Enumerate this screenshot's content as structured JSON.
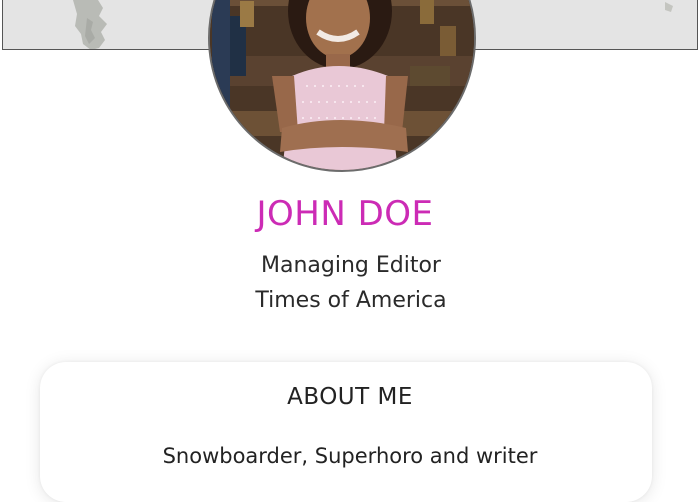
{
  "profile": {
    "name": "JOHN DOE",
    "job_title": "Managing Editor",
    "company": "Times of America",
    "name_color": "#cc2bb5"
  },
  "about": {
    "heading": "ABOUT ME",
    "text": "Snowboarder, Superhoro and writer"
  },
  "icons": {
    "banner": "world-map-banner",
    "avatar": "profile-photo"
  }
}
